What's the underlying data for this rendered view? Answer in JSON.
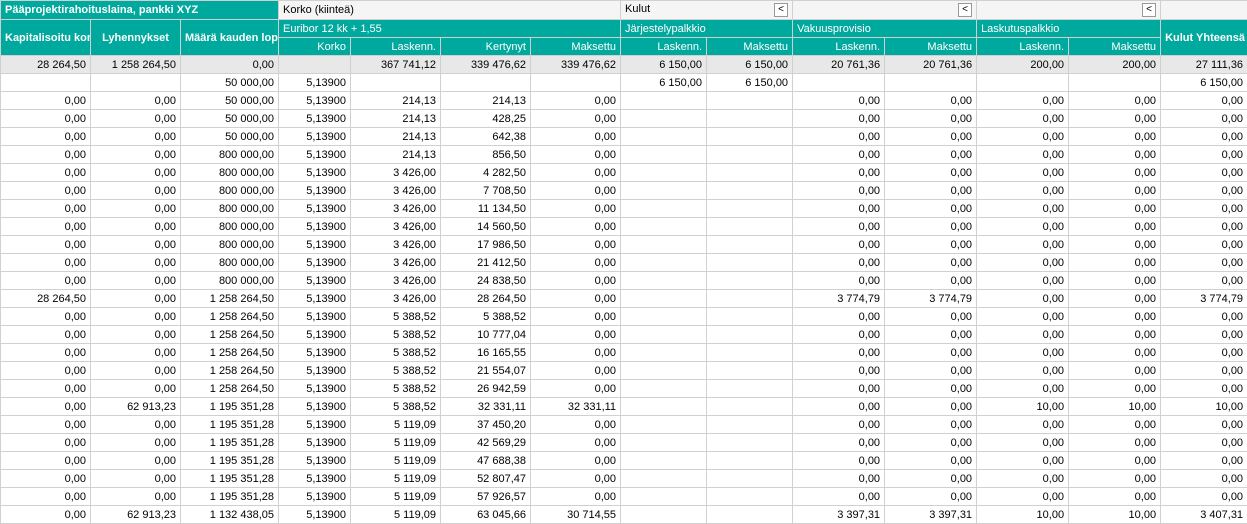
{
  "headers": {
    "main1": "Pääprojektirahoituslaina, pankki XYZ",
    "korko_kiintea": "Korko (kiinteä)",
    "kulut": "Kulut",
    "kap_korko": "Kapitalisoitu korko",
    "lyhennykset": "Lyhennykset",
    "maara_lopussa": "Määrä kauden lopussa",
    "euribor": "Euribor 12 kk + 1,55",
    "jarjestely": "Järjestelypalkkio",
    "vakuus": "Vakuusprovisio",
    "laskutus": "Laskutuspalkkio",
    "kulut_yht": "Kulut Yhteensä",
    "korko": "Korko",
    "laskenn": "Laskenn.",
    "kertynyt": "Kertynyt",
    "maksettu": "Maksettu",
    "collapse": "<"
  },
  "summary": {
    "kap": "28 264,50",
    "lyh": "1 258 264,50",
    "maara": "0,00",
    "korko": "",
    "lask": "367 741,12",
    "kert": "339 476,62",
    "maks": "339 476,62",
    "jl": "6 150,00",
    "jm": "6 150,00",
    "vl": "20 761,36",
    "vm": "20 761,36",
    "ll": "200,00",
    "lm": "200,00",
    "tot": "27 111,36"
  },
  "rows": [
    {
      "kap": "",
      "lyh": "",
      "maara": "50 000,00",
      "korko": "5,13900",
      "lask": "",
      "kert": "",
      "maks": "",
      "jl": "6 150,00",
      "jm": "6 150,00",
      "vl": "",
      "vm": "",
      "ll": "",
      "lm": "",
      "tot": "6 150,00"
    },
    {
      "kap": "0,00",
      "lyh": "0,00",
      "maara": "50 000,00",
      "korko": "5,13900",
      "lask": "214,13",
      "kert": "214,13",
      "maks": "0,00",
      "jl": "",
      "jm": "",
      "vl": "0,00",
      "vm": "0,00",
      "ll": "0,00",
      "lm": "0,00",
      "tot": "0,00"
    },
    {
      "kap": "0,00",
      "lyh": "0,00",
      "maara": "50 000,00",
      "korko": "5,13900",
      "lask": "214,13",
      "kert": "428,25",
      "maks": "0,00",
      "jl": "",
      "jm": "",
      "vl": "0,00",
      "vm": "0,00",
      "ll": "0,00",
      "lm": "0,00",
      "tot": "0,00"
    },
    {
      "kap": "0,00",
      "lyh": "0,00",
      "maara": "50 000,00",
      "korko": "5,13900",
      "lask": "214,13",
      "kert": "642,38",
      "maks": "0,00",
      "jl": "",
      "jm": "",
      "vl": "0,00",
      "vm": "0,00",
      "ll": "0,00",
      "lm": "0,00",
      "tot": "0,00"
    },
    {
      "kap": "0,00",
      "lyh": "0,00",
      "maara": "800 000,00",
      "korko": "5,13900",
      "lask": "214,13",
      "kert": "856,50",
      "maks": "0,00",
      "jl": "",
      "jm": "",
      "vl": "0,00",
      "vm": "0,00",
      "ll": "0,00",
      "lm": "0,00",
      "tot": "0,00"
    },
    {
      "kap": "0,00",
      "lyh": "0,00",
      "maara": "800 000,00",
      "korko": "5,13900",
      "lask": "3 426,00",
      "kert": "4 282,50",
      "maks": "0,00",
      "jl": "",
      "jm": "",
      "vl": "0,00",
      "vm": "0,00",
      "ll": "0,00",
      "lm": "0,00",
      "tot": "0,00"
    },
    {
      "kap": "0,00",
      "lyh": "0,00",
      "maara": "800 000,00",
      "korko": "5,13900",
      "lask": "3 426,00",
      "kert": "7 708,50",
      "maks": "0,00",
      "jl": "",
      "jm": "",
      "vl": "0,00",
      "vm": "0,00",
      "ll": "0,00",
      "lm": "0,00",
      "tot": "0,00"
    },
    {
      "kap": "0,00",
      "lyh": "0,00",
      "maara": "800 000,00",
      "korko": "5,13900",
      "lask": "3 426,00",
      "kert": "11 134,50",
      "maks": "0,00",
      "jl": "",
      "jm": "",
      "vl": "0,00",
      "vm": "0,00",
      "ll": "0,00",
      "lm": "0,00",
      "tot": "0,00"
    },
    {
      "kap": "0,00",
      "lyh": "0,00",
      "maara": "800 000,00",
      "korko": "5,13900",
      "lask": "3 426,00",
      "kert": "14 560,50",
      "maks": "0,00",
      "jl": "",
      "jm": "",
      "vl": "0,00",
      "vm": "0,00",
      "ll": "0,00",
      "lm": "0,00",
      "tot": "0,00"
    },
    {
      "kap": "0,00",
      "lyh": "0,00",
      "maara": "800 000,00",
      "korko": "5,13900",
      "lask": "3 426,00",
      "kert": "17 986,50",
      "maks": "0,00",
      "jl": "",
      "jm": "",
      "vl": "0,00",
      "vm": "0,00",
      "ll": "0,00",
      "lm": "0,00",
      "tot": "0,00"
    },
    {
      "kap": "0,00",
      "lyh": "0,00",
      "maara": "800 000,00",
      "korko": "5,13900",
      "lask": "3 426,00",
      "kert": "21 412,50",
      "maks": "0,00",
      "jl": "",
      "jm": "",
      "vl": "0,00",
      "vm": "0,00",
      "ll": "0,00",
      "lm": "0,00",
      "tot": "0,00"
    },
    {
      "kap": "0,00",
      "lyh": "0,00",
      "maara": "800 000,00",
      "korko": "5,13900",
      "lask": "3 426,00",
      "kert": "24 838,50",
      "maks": "0,00",
      "jl": "",
      "jm": "",
      "vl": "0,00",
      "vm": "0,00",
      "ll": "0,00",
      "lm": "0,00",
      "tot": "0,00"
    },
    {
      "kap": "28 264,50",
      "lyh": "0,00",
      "maara": "1 258 264,50",
      "korko": "5,13900",
      "lask": "3 426,00",
      "kert": "28 264,50",
      "maks": "0,00",
      "jl": "",
      "jm": "",
      "vl": "3 774,79",
      "vm": "3 774,79",
      "ll": "0,00",
      "lm": "0,00",
      "tot": "3 774,79"
    },
    {
      "kap": "0,00",
      "lyh": "0,00",
      "maara": "1 258 264,50",
      "korko": "5,13900",
      "lask": "5 388,52",
      "kert": "5 388,52",
      "maks": "0,00",
      "jl": "",
      "jm": "",
      "vl": "0,00",
      "vm": "0,00",
      "ll": "0,00",
      "lm": "0,00",
      "tot": "0,00"
    },
    {
      "kap": "0,00",
      "lyh": "0,00",
      "maara": "1 258 264,50",
      "korko": "5,13900",
      "lask": "5 388,52",
      "kert": "10 777,04",
      "maks": "0,00",
      "jl": "",
      "jm": "",
      "vl": "0,00",
      "vm": "0,00",
      "ll": "0,00",
      "lm": "0,00",
      "tot": "0,00"
    },
    {
      "kap": "0,00",
      "lyh": "0,00",
      "maara": "1 258 264,50",
      "korko": "5,13900",
      "lask": "5 388,52",
      "kert": "16 165,55",
      "maks": "0,00",
      "jl": "",
      "jm": "",
      "vl": "0,00",
      "vm": "0,00",
      "ll": "0,00",
      "lm": "0,00",
      "tot": "0,00"
    },
    {
      "kap": "0,00",
      "lyh": "0,00",
      "maara": "1 258 264,50",
      "korko": "5,13900",
      "lask": "5 388,52",
      "kert": "21 554,07",
      "maks": "0,00",
      "jl": "",
      "jm": "",
      "vl": "0,00",
      "vm": "0,00",
      "ll": "0,00",
      "lm": "0,00",
      "tot": "0,00"
    },
    {
      "kap": "0,00",
      "lyh": "0,00",
      "maara": "1 258 264,50",
      "korko": "5,13900",
      "lask": "5 388,52",
      "kert": "26 942,59",
      "maks": "0,00",
      "jl": "",
      "jm": "",
      "vl": "0,00",
      "vm": "0,00",
      "ll": "0,00",
      "lm": "0,00",
      "tot": "0,00"
    },
    {
      "kap": "0,00",
      "lyh": "62 913,23",
      "maara": "1 195 351,28",
      "korko": "5,13900",
      "lask": "5 388,52",
      "kert": "32 331,11",
      "maks": "32 331,11",
      "jl": "",
      "jm": "",
      "vl": "0,00",
      "vm": "0,00",
      "ll": "10,00",
      "lm": "10,00",
      "tot": "10,00"
    },
    {
      "kap": "0,00",
      "lyh": "0,00",
      "maara": "1 195 351,28",
      "korko": "5,13900",
      "lask": "5 119,09",
      "kert": "37 450,20",
      "maks": "0,00",
      "jl": "",
      "jm": "",
      "vl": "0,00",
      "vm": "0,00",
      "ll": "0,00",
      "lm": "0,00",
      "tot": "0,00"
    },
    {
      "kap": "0,00",
      "lyh": "0,00",
      "maara": "1 195 351,28",
      "korko": "5,13900",
      "lask": "5 119,09",
      "kert": "42 569,29",
      "maks": "0,00",
      "jl": "",
      "jm": "",
      "vl": "0,00",
      "vm": "0,00",
      "ll": "0,00",
      "lm": "0,00",
      "tot": "0,00"
    },
    {
      "kap": "0,00",
      "lyh": "0,00",
      "maara": "1 195 351,28",
      "korko": "5,13900",
      "lask": "5 119,09",
      "kert": "47 688,38",
      "maks": "0,00",
      "jl": "",
      "jm": "",
      "vl": "0,00",
      "vm": "0,00",
      "ll": "0,00",
      "lm": "0,00",
      "tot": "0,00"
    },
    {
      "kap": "0,00",
      "lyh": "0,00",
      "maara": "1 195 351,28",
      "korko": "5,13900",
      "lask": "5 119,09",
      "kert": "52 807,47",
      "maks": "0,00",
      "jl": "",
      "jm": "",
      "vl": "0,00",
      "vm": "0,00",
      "ll": "0,00",
      "lm": "0,00",
      "tot": "0,00"
    },
    {
      "kap": "0,00",
      "lyh": "0,00",
      "maara": "1 195 351,28",
      "korko": "5,13900",
      "lask": "5 119,09",
      "kert": "57 926,57",
      "maks": "0,00",
      "jl": "",
      "jm": "",
      "vl": "0,00",
      "vm": "0,00",
      "ll": "0,00",
      "lm": "0,00",
      "tot": "0,00"
    },
    {
      "kap": "0,00",
      "lyh": "62 913,23",
      "maara": "1 132 438,05",
      "korko": "5,13900",
      "lask": "5 119,09",
      "kert": "63 045,66",
      "maks": "30 714,55",
      "jl": "",
      "jm": "",
      "vl": "3 397,31",
      "vm": "3 397,31",
      "ll": "10,00",
      "lm": "10,00",
      "tot": "3 407,31"
    }
  ]
}
